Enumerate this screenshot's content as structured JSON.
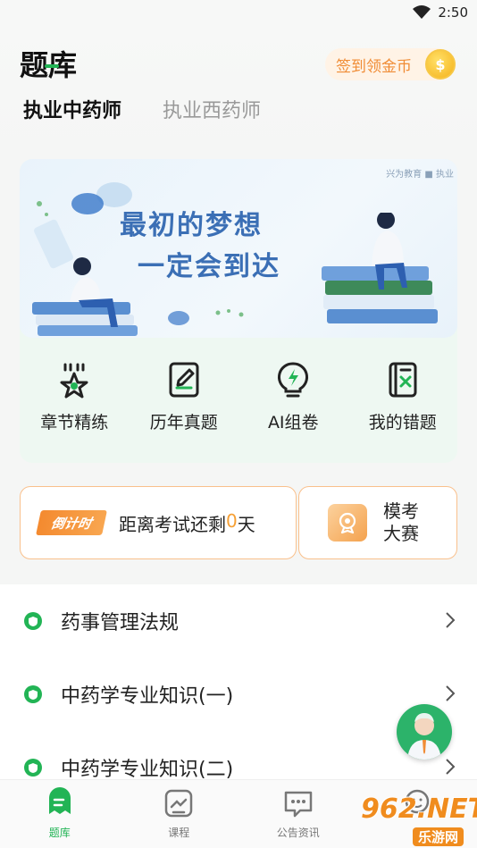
{
  "status_bar": {
    "time": "2:50"
  },
  "header": {
    "title": "题库",
    "signin_label": "签到领金币",
    "coin_symbol": "$"
  },
  "tabs": [
    {
      "label": "执业中药师",
      "active": true
    },
    {
      "label": "执业西药师",
      "active": false
    }
  ],
  "banner": {
    "brand": "兴为教育 ■ 执业",
    "slogan_line1": "最初的梦想",
    "slogan_line2": "一定会到达"
  },
  "quick_actions": [
    {
      "label": "章节精练",
      "icon": "star-badge-icon"
    },
    {
      "label": "历年真题",
      "icon": "pen-paper-icon"
    },
    {
      "label": "AI组卷",
      "icon": "lightning-bulb-icon"
    },
    {
      "label": "我的错题",
      "icon": "error-book-icon"
    }
  ],
  "countdown": {
    "badge": "倒计时",
    "prefix": "距离考试还剩",
    "days": "0",
    "suffix": "天"
  },
  "mock_exam": {
    "label": "模考大赛"
  },
  "subjects": [
    {
      "label": "药事管理法规"
    },
    {
      "label": "中药学专业知识(一)"
    },
    {
      "label": "中药学专业知识(二)"
    }
  ],
  "bottom_nav": [
    {
      "label": "题库",
      "icon": "question-bank-icon",
      "active": true
    },
    {
      "label": "课程",
      "icon": "course-icon",
      "active": false
    },
    {
      "label": "公告资讯",
      "icon": "chat-notice-icon",
      "active": false
    },
    {
      "label": "",
      "icon": "profile-icon",
      "active": false
    }
  ],
  "watermark": {
    "main": "962.NET",
    "sub": "乐游网"
  },
  "colors": {
    "accent": "#22b455",
    "orange": "#f08c35",
    "banner_text": "#3b6fb5"
  }
}
